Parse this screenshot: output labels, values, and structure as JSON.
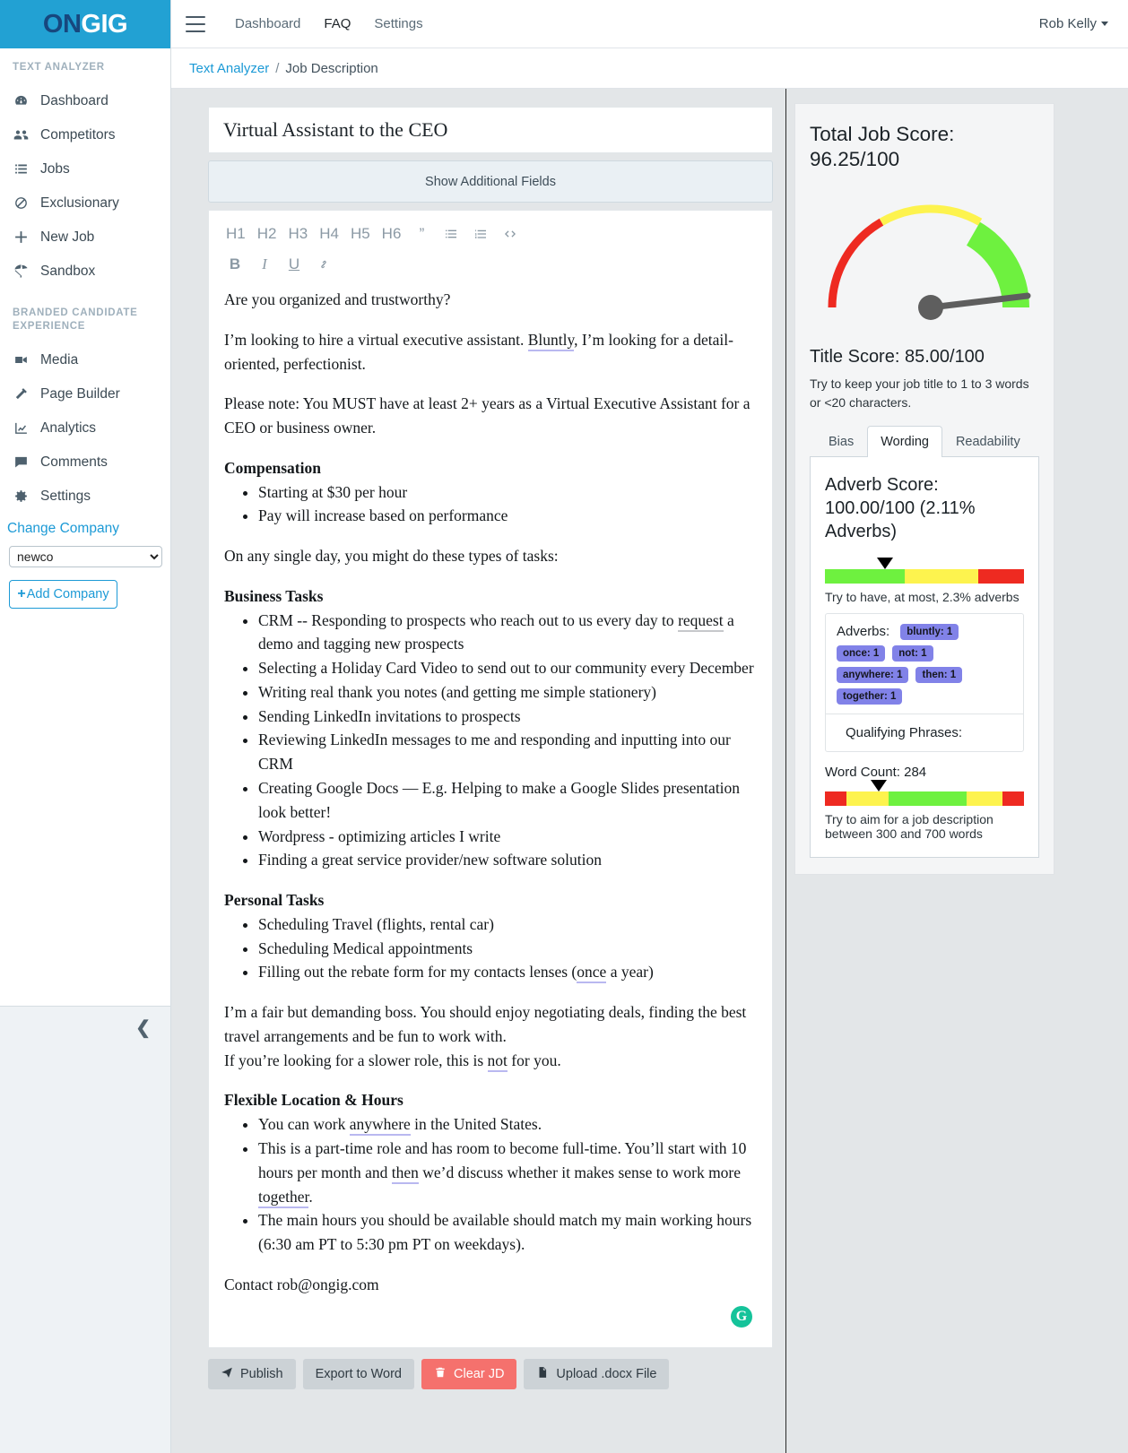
{
  "brand": {
    "logo_on": "ON",
    "logo_gig": "GIG",
    "logo_bg": "#22a1d3",
    "accent": "#1c9ad6"
  },
  "sidebar": {
    "section1_title": "TEXT ANALYZER",
    "section1_items": [
      {
        "label": "Dashboard",
        "icon": "speedometer-icon"
      },
      {
        "label": "Competitors",
        "icon": "users-icon"
      },
      {
        "label": "Jobs",
        "icon": "list-icon"
      },
      {
        "label": "Exclusionary",
        "icon": "ban-icon"
      },
      {
        "label": "New Job",
        "icon": "plus-icon"
      },
      {
        "label": "Sandbox",
        "icon": "beach-umbrella-icon"
      }
    ],
    "section2_title": "BRANDED CANDIDATE EXPERIENCE",
    "section2_items": [
      {
        "label": "Media",
        "icon": "video-camera-icon"
      },
      {
        "label": "Page Builder",
        "icon": "hammer-icon"
      },
      {
        "label": "Analytics",
        "icon": "chart-line-icon"
      },
      {
        "label": "Comments",
        "icon": "comment-icon"
      },
      {
        "label": "Settings",
        "icon": "gear-icon"
      }
    ],
    "change_company_label": "Change Company",
    "company_selected": "newco",
    "company_options": [
      "newco"
    ],
    "add_company_label": "Add Company",
    "collapse_icon": "chevron-left-icon"
  },
  "topbar": {
    "menu_icon": "hamburger-icon",
    "links": [
      {
        "label": "Dashboard",
        "active": false
      },
      {
        "label": "FAQ",
        "active": true
      },
      {
        "label": "Settings",
        "active": false
      }
    ],
    "user_name": "Rob Kelly"
  },
  "breadcrumb": {
    "root": "Text Analyzer",
    "separator": "/",
    "current": "Job Description"
  },
  "editor": {
    "job_title": "Virtual Assistant to the CEO",
    "show_additional_fields_label": "Show Additional Fields",
    "toolbar_row1": [
      "H1",
      "H2",
      "H3",
      "H4",
      "H5",
      "H6"
    ],
    "toolbar_icons_row1": [
      "quote-icon",
      "bullet-list-icon",
      "numbered-list-icon",
      "code-icon"
    ],
    "toolbar_row2": [
      "B",
      "I",
      "U"
    ],
    "toolbar_icons_row2": [
      "link-icon"
    ],
    "grammarly_icon": "grammarly-icon",
    "body": {
      "p1": "Are you organized and trustworthy?",
      "p2_a": "I’m looking to hire a virtual executive assistant. ",
      "p2_adv": "Bluntly",
      "p2_b": ", I’m looking for a detail-oriented, perfectionist.",
      "p3": "Please note: You MUST have at least 2+ years as a Virtual Executive Assistant for a CEO or business owner.",
      "h_compensation": "Compensation",
      "compensation_items": [
        "Starting at $30 per hour",
        "Pay will increase based on performance"
      ],
      "p4": "On any single day, you might do these types of tasks:",
      "h_business": "Business Tasks",
      "business_items_1a": "CRM -- Responding to prospects who reach out to us every day to ",
      "business_items_1adv": "request",
      "business_items_1b": " a demo and tagging new prospects",
      "business_items_rest": [
        "Selecting a Holiday Card Video to send out to our community every December",
        "Writing real thank you notes (and getting me simple stationery)",
        "Sending LinkedIn invitations to prospects",
        "Reviewing LinkedIn messages to me and responding and inputting into our CRM",
        "Creating Google Docs — E.g. Helping to make a Google Slides presentation look better!",
        "Wordpress - optimizing articles I write",
        "Finding a great service provider/new software solution"
      ],
      "h_personal": "Personal Tasks",
      "personal_items": [
        "Scheduling Travel (flights, rental car)",
        "Scheduling Medical appointments"
      ],
      "personal_last_a": "Filling out the rebate form for my contacts lenses (",
      "personal_last_adv": "once",
      "personal_last_b": " a year)",
      "p5": "I’m a fair but demanding boss. You should enjoy negotiating deals, finding the best travel arrangements and be fun to work with.",
      "p6_a": "If you’re looking for a slower role, this is ",
      "p6_adv": "not",
      "p6_b": " for you.",
      "h_flexible": "Flexible Location & Hours",
      "flex_1a": "You can work ",
      "flex_1adv": "anywhere",
      "flex_1b": " in the United States.",
      "flex_2a": "This is a part-time role and has room to become full-time. You’ll start with 10 hours per month and ",
      "flex_2adv1": "then",
      "flex_2b": " we’d discuss whether it makes sense to work more ",
      "flex_2adv2": "together",
      "flex_2c": ".",
      "flex_3": "The main hours you should be available should match my main working hours (6:30 am PT to 5:30 pm PT on weekdays).",
      "p7": "Contact rob@ongig.com"
    },
    "actions": [
      {
        "label": "Publish",
        "icon": "paper-plane-icon",
        "style": "default"
      },
      {
        "label": "Export to Word",
        "icon": "",
        "style": "default"
      },
      {
        "label": "Clear JD",
        "icon": "trash-icon",
        "style": "danger"
      },
      {
        "label": "Upload .docx File",
        "icon": "file-icon",
        "style": "default"
      }
    ]
  },
  "score_panel": {
    "total_score_label": "Total Job Score:",
    "total_score_value": "96.25/100",
    "title_score": "Title Score: 85.00/100",
    "title_note": "Try to keep your job title to 1 to 3 words or <20 characters.",
    "tabs": [
      {
        "label": "Bias",
        "active": false
      },
      {
        "label": "Wording",
        "active": true
      },
      {
        "label": "Readability",
        "active": false
      }
    ],
    "adverb_score": "Adverb Score: 100.00/100 (2.11% Adverbs)",
    "adverb_note": "Try to have, at most, 2.3% adverbs",
    "adverbs_label": "Adverbs:",
    "adverb_badges": [
      "bluntly: 1",
      "once: 1",
      "not: 1",
      "anywhere: 1",
      "then: 1",
      "together: 1"
    ],
    "qualifying_label": "Qualifying Phrases:",
    "word_count": "Word Count: 284",
    "word_count_note": "Try to aim for a job description between 300 and 700 words"
  },
  "chart_data": [
    {
      "type": "gauge",
      "title": "Total Job Score",
      "value": 96.25,
      "min": 0,
      "max": 100,
      "needle_angle_deg": 173,
      "bands": [
        {
          "from": 0,
          "to": 33,
          "color": "#ee2a21",
          "thin": true
        },
        {
          "from": 33,
          "to": 66,
          "color": "#fdf34e",
          "thin": true
        },
        {
          "from": 66,
          "to": 100,
          "color": "#6ef13f",
          "thin": false
        }
      ]
    },
    {
      "type": "bar",
      "title": "Adverb percentage meter",
      "categories": [
        "good",
        "warn",
        "bad"
      ],
      "values": [
        40,
        37,
        23
      ],
      "colors": [
        "#6ef13f",
        "#fdf34e",
        "#ee2a21"
      ],
      "marker_position_pct": 30,
      "annotation": "2.11% adverbs; target at most 2.3%"
    },
    {
      "type": "bar",
      "title": "Word count meter",
      "categories": [
        "too-low",
        "low",
        "good",
        "high",
        "too-high"
      ],
      "values": [
        11,
        21,
        39,
        18,
        11
      ],
      "colors": [
        "#ee2a21",
        "#fdf34e",
        "#6ef13f",
        "#fdf34e",
        "#ee2a21"
      ],
      "marker_position_pct": 27,
      "annotation": "Word Count 284; target between 300 and 700 words"
    }
  ]
}
